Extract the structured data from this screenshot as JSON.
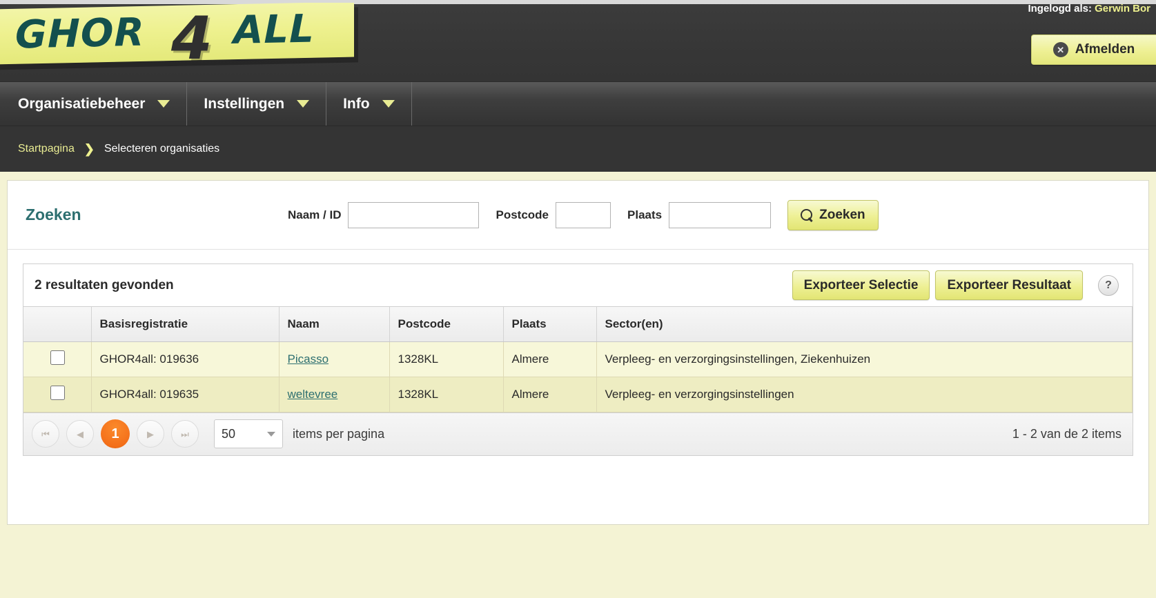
{
  "header": {
    "logo_text": "GHOR ALL",
    "logo_prefix": "GHOR",
    "logo_suffix": "ALL",
    "logo_four": "4",
    "logged_in_prefix": "Ingelogd als:",
    "logged_in_user": "Gerwin Bor",
    "logout_label": "Afmelden",
    "logout_icon": "circle-x-icon"
  },
  "nav": {
    "items": [
      {
        "label": "Organisatiebeheer",
        "icon": "chevron-down-icon"
      },
      {
        "label": "Instellingen",
        "icon": "chevron-down-icon"
      },
      {
        "label": "Info",
        "icon": "chevron-down-icon"
      }
    ]
  },
  "breadcrumb": {
    "home": "Startpagina",
    "separator": "❯",
    "current": "Selecteren organisaties"
  },
  "search": {
    "title": "Zoeken",
    "naam_label": "Naam / ID",
    "naam_value": "",
    "naam_placeholder": "",
    "postcode_label": "Postcode",
    "postcode_value": "",
    "postcode_placeholder": "",
    "plaats_label": "Plaats",
    "plaats_value": "",
    "plaats_placeholder": "",
    "button_label": "Zoeken",
    "button_icon": "search-icon"
  },
  "results": {
    "count_text": "2 resultaten gevonden",
    "export_selection_label": "Exporteer Selectie",
    "export_result_label": "Exporteer Resultaat",
    "help_icon": "question-mark-icon",
    "help_label": "?",
    "columns": [
      "",
      "Basisregistratie",
      "Naam",
      "Postcode",
      "Plaats",
      "Sector(en)"
    ],
    "rows": [
      {
        "checked": false,
        "basisregistratie": "GHOR4all: 019636",
        "naam": "Picasso",
        "postcode": "1328KL",
        "plaats": "Almere",
        "sectoren": "Verpleeg- en verzorgingsinstellingen, Ziekenhuizen"
      },
      {
        "checked": false,
        "basisregistratie": "GHOR4all: 019635",
        "naam": "weltevree",
        "postcode": "1328KL",
        "plaats": "Almere",
        "sectoren": "Verpleeg- en verzorgingsinstellingen"
      }
    ]
  },
  "pager": {
    "first_icon": "first-page-icon",
    "prev_icon": "prev-page-icon",
    "next_icon": "next-page-icon",
    "last_icon": "last-page-icon",
    "first_glyph": "⏮",
    "prev_glyph": "◀",
    "next_glyph": "▶",
    "last_glyph": "⏭",
    "current_page": "1",
    "page_size": "50",
    "page_size_label": "items per pagina",
    "range_text": "1 - 2 van de 2 items"
  },
  "colors": {
    "brand_yellow": "#eef18f",
    "brand_teal": "#2d6f70",
    "accent_orange": "#f4701a",
    "page_bg": "#f4f3d4",
    "header_dark": "#343434"
  }
}
